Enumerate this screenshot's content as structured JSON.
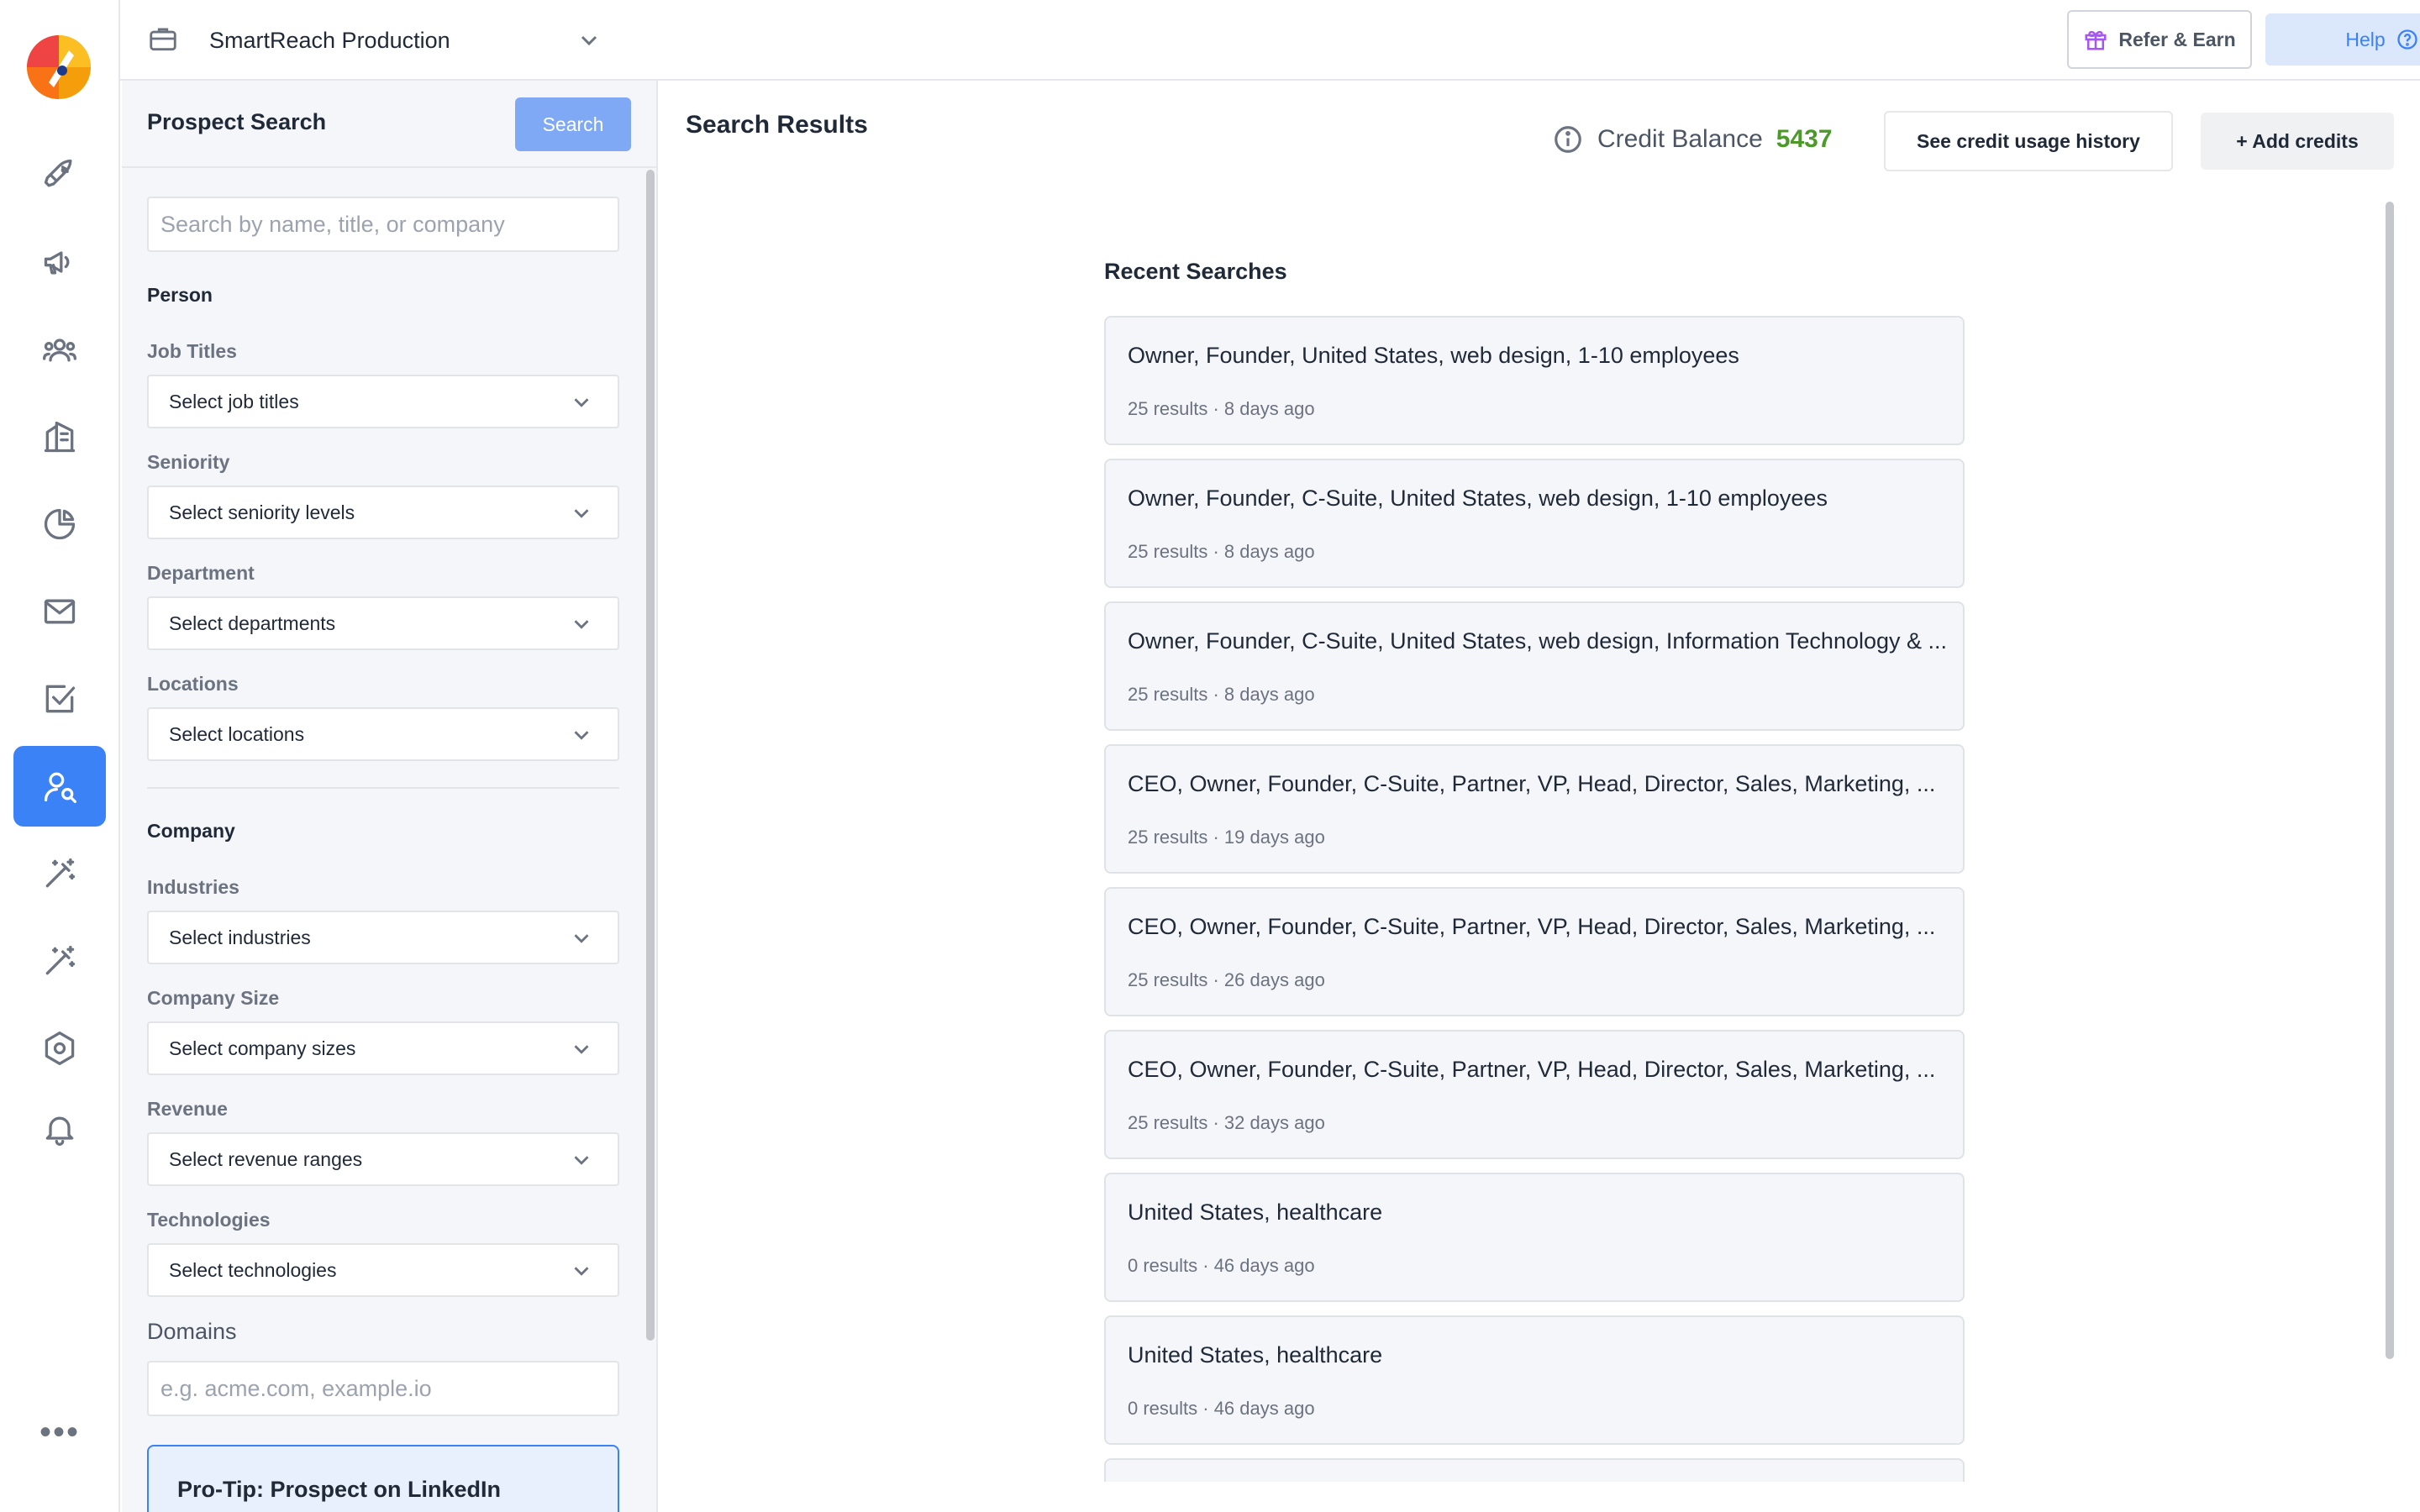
{
  "rail": {
    "items": [
      {
        "name": "rocket-icon",
        "active": false
      },
      {
        "name": "megaphone-icon",
        "active": false
      },
      {
        "name": "users-icon",
        "active": false
      },
      {
        "name": "building-icon",
        "active": false
      },
      {
        "name": "pie-chart-icon",
        "active": false
      },
      {
        "name": "mail-icon",
        "active": false
      },
      {
        "name": "checkbox-icon",
        "active": false
      },
      {
        "name": "prospect-search-icon",
        "active": true
      },
      {
        "name": "magic-wand-icon",
        "active": false
      },
      {
        "name": "magic-wand-alt-icon",
        "active": false
      },
      {
        "name": "settings-hexagon-icon",
        "active": false
      },
      {
        "name": "bell-icon",
        "active": false
      }
    ],
    "more_label": "•••"
  },
  "topbar": {
    "workspace_name": "SmartReach Production",
    "refer_label": "Refer & Earn",
    "help_label": "Help"
  },
  "panel": {
    "title": "Prospect Search",
    "search_button": "Search",
    "search_placeholder": "Search by name, title, or company",
    "person_section": "Person",
    "company_section": "Company",
    "filters": {
      "job_titles": {
        "label": "Job Titles",
        "value": "Select job titles"
      },
      "seniority": {
        "label": "Seniority",
        "value": "Select seniority levels"
      },
      "department": {
        "label": "Department",
        "value": "Select departments"
      },
      "locations": {
        "label": "Locations",
        "value": "Select locations"
      },
      "industries": {
        "label": "Industries",
        "value": "Select industries"
      },
      "company_size": {
        "label": "Company Size",
        "value": "Select company sizes"
      },
      "revenue": {
        "label": "Revenue",
        "value": "Select revenue ranges"
      },
      "technologies": {
        "label": "Technologies",
        "value": "Select technologies"
      }
    },
    "domains_label": "Domains",
    "domains_placeholder": "e.g. acme.com, example.io",
    "protip": "Pro-Tip: Prospect on LinkedIn"
  },
  "main": {
    "title": "Search Results",
    "credit_label": "Credit Balance",
    "credit_value": "5437",
    "usage_button": "See credit usage history",
    "add_credits_button": "+ Add credits",
    "recent_title": "Recent Searches",
    "recent": [
      {
        "query": "Owner, Founder, United States, web design, 1-10 employees",
        "meta": "25 results · 8 days ago"
      },
      {
        "query": "Owner, Founder, C-Suite, United States, web design, 1-10 employees",
        "meta": "25 results · 8 days ago"
      },
      {
        "query": "Owner, Founder, C-Suite, United States, web design, Information Technology & ...",
        "meta": "25 results · 8 days ago"
      },
      {
        "query": "CEO, Owner, Founder, C-Suite, Partner, VP, Head, Director, Sales, Marketing, ...",
        "meta": "25 results · 19 days ago"
      },
      {
        "query": "CEO, Owner, Founder, C-Suite, Partner, VP, Head, Director, Sales, Marketing, ...",
        "meta": "25 results · 26 days ago"
      },
      {
        "query": "CEO, Owner, Founder, C-Suite, Partner, VP, Head, Director, Sales, Marketing, ...",
        "meta": "25 results · 32 days ago"
      },
      {
        "query": "United States, healthcare",
        "meta": "0 results · 46 days ago"
      },
      {
        "query": "United States, healthcare",
        "meta": "0 results · 46 days ago"
      },
      {
        "query": "",
        "meta": ""
      }
    ]
  }
}
